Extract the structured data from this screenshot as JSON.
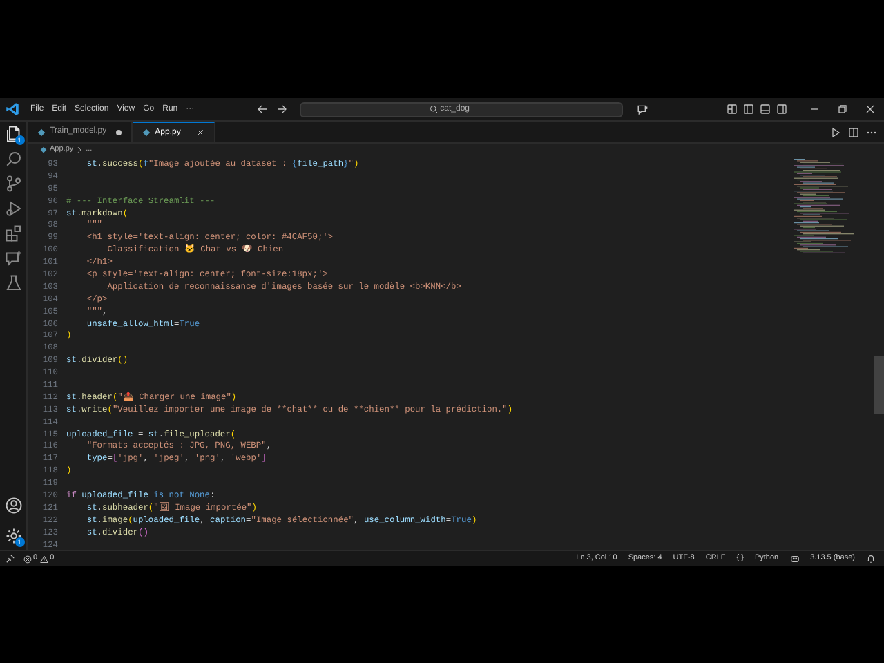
{
  "menu": [
    "File",
    "Edit",
    "Selection",
    "View",
    "Go",
    "Run",
    "···"
  ],
  "search": {
    "value": "cat_dog"
  },
  "activity_bar": [
    {
      "kind": "explorer",
      "selected": true,
      "badge": "1"
    },
    {
      "kind": "search",
      "selected": false
    },
    {
      "kind": "source-control",
      "selected": false
    },
    {
      "kind": "run",
      "selected": false
    },
    {
      "kind": "extensions",
      "selected": false
    },
    {
      "kind": "chat",
      "selected": false
    },
    {
      "kind": "testing",
      "selected": false
    }
  ],
  "activity_bottom": [
    {
      "kind": "account"
    },
    {
      "kind": "settings",
      "badge": "1"
    }
  ],
  "tabs": [
    {
      "label": "Train_model.py",
      "selected": false,
      "modified": true
    },
    {
      "label": "App.py",
      "selected": true,
      "modified": false
    }
  ],
  "breadcrumbs": [
    "App.py",
    "..."
  ],
  "editor": {
    "lines": [
      {
        "number": "93",
        "tokens": [
          {
            "text": "    st",
            "kind": "variable"
          },
          {
            "text": ".",
            "kind": "plain"
          },
          {
            "text": "success",
            "kind": "function"
          },
          {
            "text": "(",
            "kind": "bracket"
          },
          {
            "text": "f",
            "kind": "constant"
          },
          {
            "text": "\"Image ajoutée au dataset : ",
            "kind": "string"
          },
          {
            "text": "{",
            "kind": "constant"
          },
          {
            "text": "file_path",
            "kind": "variable"
          },
          {
            "text": "}",
            "kind": "constant"
          },
          {
            "text": "\"",
            "kind": "string"
          },
          {
            "text": ")",
            "kind": "bracket"
          }
        ]
      },
      {
        "number": "94"
      },
      {
        "number": "95"
      },
      {
        "number": "96",
        "tokens": [
          {
            "text": "# --- Interface Streamlit ---",
            "kind": "comment"
          }
        ]
      },
      {
        "number": "97",
        "tokens": [
          {
            "text": "st",
            "kind": "variable"
          },
          {
            "text": ".",
            "kind": "plain"
          },
          {
            "text": "markdown",
            "kind": "function"
          },
          {
            "text": "(",
            "kind": "bracket"
          }
        ]
      },
      {
        "number": "98",
        "tokens": [
          {
            "text": "    \"\"\"",
            "kind": "string"
          }
        ]
      },
      {
        "number": "99",
        "tokens": [
          {
            "text": "    <h1 style='text-align: center; color: #4CAF50;'>",
            "kind": "string"
          }
        ]
      },
      {
        "number": "100",
        "tokens": [
          {
            "text": "        Classification 🐱 Chat vs 🐶 Chien",
            "kind": "string"
          }
        ]
      },
      {
        "number": "101",
        "tokens": [
          {
            "text": "    </h1>",
            "kind": "string"
          }
        ]
      },
      {
        "number": "102",
        "tokens": [
          {
            "text": "    <p style='text-align: center; font-size:18px;'>",
            "kind": "string"
          }
        ]
      },
      {
        "number": "103",
        "tokens": [
          {
            "text": "        Application de reconnaissance d'images basée sur le modèle <b>KNN</b>",
            "kind": "string"
          }
        ]
      },
      {
        "number": "104",
        "tokens": [
          {
            "text": "    </p>",
            "kind": "string"
          }
        ]
      },
      {
        "number": "105",
        "tokens": [
          {
            "text": "    \"\"\"",
            "kind": "string"
          },
          {
            "text": ",",
            "kind": "plain"
          }
        ]
      },
      {
        "number": "106",
        "tokens": [
          {
            "text": "    unsafe_allow_html",
            "kind": "variable"
          },
          {
            "text": "=",
            "kind": "plain"
          },
          {
            "text": "True",
            "kind": "constant"
          }
        ]
      },
      {
        "number": "107",
        "tokens": [
          {
            "text": ")",
            "kind": "bracket"
          }
        ]
      },
      {
        "number": "108"
      },
      {
        "number": "109",
        "tokens": [
          {
            "text": "st",
            "kind": "variable"
          },
          {
            "text": ".",
            "kind": "plain"
          },
          {
            "text": "divider",
            "kind": "function"
          },
          {
            "text": "()",
            "kind": "bracket"
          }
        ]
      },
      {
        "number": "110"
      },
      {
        "number": "111"
      },
      {
        "number": "112",
        "tokens": [
          {
            "text": "st",
            "kind": "variable"
          },
          {
            "text": ".",
            "kind": "plain"
          },
          {
            "text": "header",
            "kind": "function"
          },
          {
            "text": "(",
            "kind": "bracket"
          },
          {
            "text": "\"📤 Charger une image\"",
            "kind": "string"
          },
          {
            "text": ")",
            "kind": "bracket"
          }
        ]
      },
      {
        "number": "113",
        "tokens": [
          {
            "text": "st",
            "kind": "variable"
          },
          {
            "text": ".",
            "kind": "plain"
          },
          {
            "text": "write",
            "kind": "function"
          },
          {
            "text": "(",
            "kind": "bracket"
          },
          {
            "text": "\"Veuillez importer une image de **chat** ou de **chien** pour la prédiction.\"",
            "kind": "string"
          },
          {
            "text": ")",
            "kind": "bracket"
          }
        ]
      },
      {
        "number": "114"
      },
      {
        "number": "115",
        "tokens": [
          {
            "text": "uploaded_file",
            "kind": "variable"
          },
          {
            "text": " = ",
            "kind": "plain"
          },
          {
            "text": "st",
            "kind": "variable"
          },
          {
            "text": ".",
            "kind": "plain"
          },
          {
            "text": "file_uploader",
            "kind": "function"
          },
          {
            "text": "(",
            "kind": "bracket"
          }
        ]
      },
      {
        "number": "116",
        "tokens": [
          {
            "text": "    \"Formats acceptés : JPG, PNG, WEBP\"",
            "kind": "string"
          },
          {
            "text": ",",
            "kind": "plain"
          }
        ]
      },
      {
        "number": "117",
        "tokens": [
          {
            "text": "    type",
            "kind": "variable"
          },
          {
            "text": "=",
            "kind": "plain"
          },
          {
            "text": "[",
            "kind": "bracket2"
          },
          {
            "text": "'jpg'",
            "kind": "string"
          },
          {
            "text": ", ",
            "kind": "plain"
          },
          {
            "text": "'jpeg'",
            "kind": "string"
          },
          {
            "text": ", ",
            "kind": "plain"
          },
          {
            "text": "'png'",
            "kind": "string"
          },
          {
            "text": ", ",
            "kind": "plain"
          },
          {
            "text": "'webp'",
            "kind": "string"
          },
          {
            "text": "]",
            "kind": "bracket2"
          }
        ]
      },
      {
        "number": "118",
        "tokens": [
          {
            "text": ")",
            "kind": "bracket"
          }
        ]
      },
      {
        "number": "119"
      },
      {
        "number": "120",
        "tokens": [
          {
            "text": "if ",
            "kind": "keyword"
          },
          {
            "text": "uploaded_file ",
            "kind": "variable"
          },
          {
            "text": "is not ",
            "kind": "constant"
          },
          {
            "text": "None",
            "kind": "constant"
          },
          {
            "text": ":",
            "kind": "plain"
          }
        ]
      },
      {
        "number": "121",
        "tokens": [
          {
            "text": "    st",
            "kind": "variable"
          },
          {
            "text": ".",
            "kind": "plain"
          },
          {
            "text": "subheader",
            "kind": "function"
          },
          {
            "text": "(",
            "kind": "bracket"
          },
          {
            "text": "\"🖼 Image importée\"",
            "kind": "string"
          },
          {
            "text": ")",
            "kind": "bracket"
          }
        ]
      },
      {
        "number": "122",
        "tokens": [
          {
            "text": "    st",
            "kind": "variable"
          },
          {
            "text": ".",
            "kind": "plain"
          },
          {
            "text": "image",
            "kind": "function"
          },
          {
            "text": "(",
            "kind": "bracket"
          },
          {
            "text": "uploaded_file",
            "kind": "variable"
          },
          {
            "text": ", ",
            "kind": "plain"
          },
          {
            "text": "caption",
            "kind": "variable"
          },
          {
            "text": "=",
            "kind": "plain"
          },
          {
            "text": "\"Image sélectionnée\"",
            "kind": "string"
          },
          {
            "text": ", ",
            "kind": "plain"
          },
          {
            "text": "use_column_width",
            "kind": "variable"
          },
          {
            "text": "=",
            "kind": "plain"
          },
          {
            "text": "True",
            "kind": "constant"
          },
          {
            "text": ")",
            "kind": "bracket"
          }
        ]
      },
      {
        "number": "123",
        "tokens": [
          {
            "text": "    st",
            "kind": "variable"
          },
          {
            "text": ".",
            "kind": "plain"
          },
          {
            "text": "divider",
            "kind": "function"
          },
          {
            "text": "()",
            "kind": "bracket2"
          }
        ]
      },
      {
        "number": "124"
      }
    ]
  },
  "status_bar": {
    "errors": "0",
    "warnings": "0",
    "items": [
      {
        "kind": "text",
        "label": "Ln 3, Col 10"
      },
      {
        "kind": "text",
        "label": "Spaces: 4"
      },
      {
        "kind": "text",
        "label": "UTF-8"
      },
      {
        "kind": "text",
        "label": "CRLF"
      },
      {
        "kind": "text",
        "label": "{ }"
      },
      {
        "kind": "text",
        "label": "Python"
      },
      {
        "kind": "copilot"
      },
      {
        "kind": "text",
        "label": "3.13.5 (base)"
      },
      {
        "kind": "bell"
      }
    ]
  }
}
